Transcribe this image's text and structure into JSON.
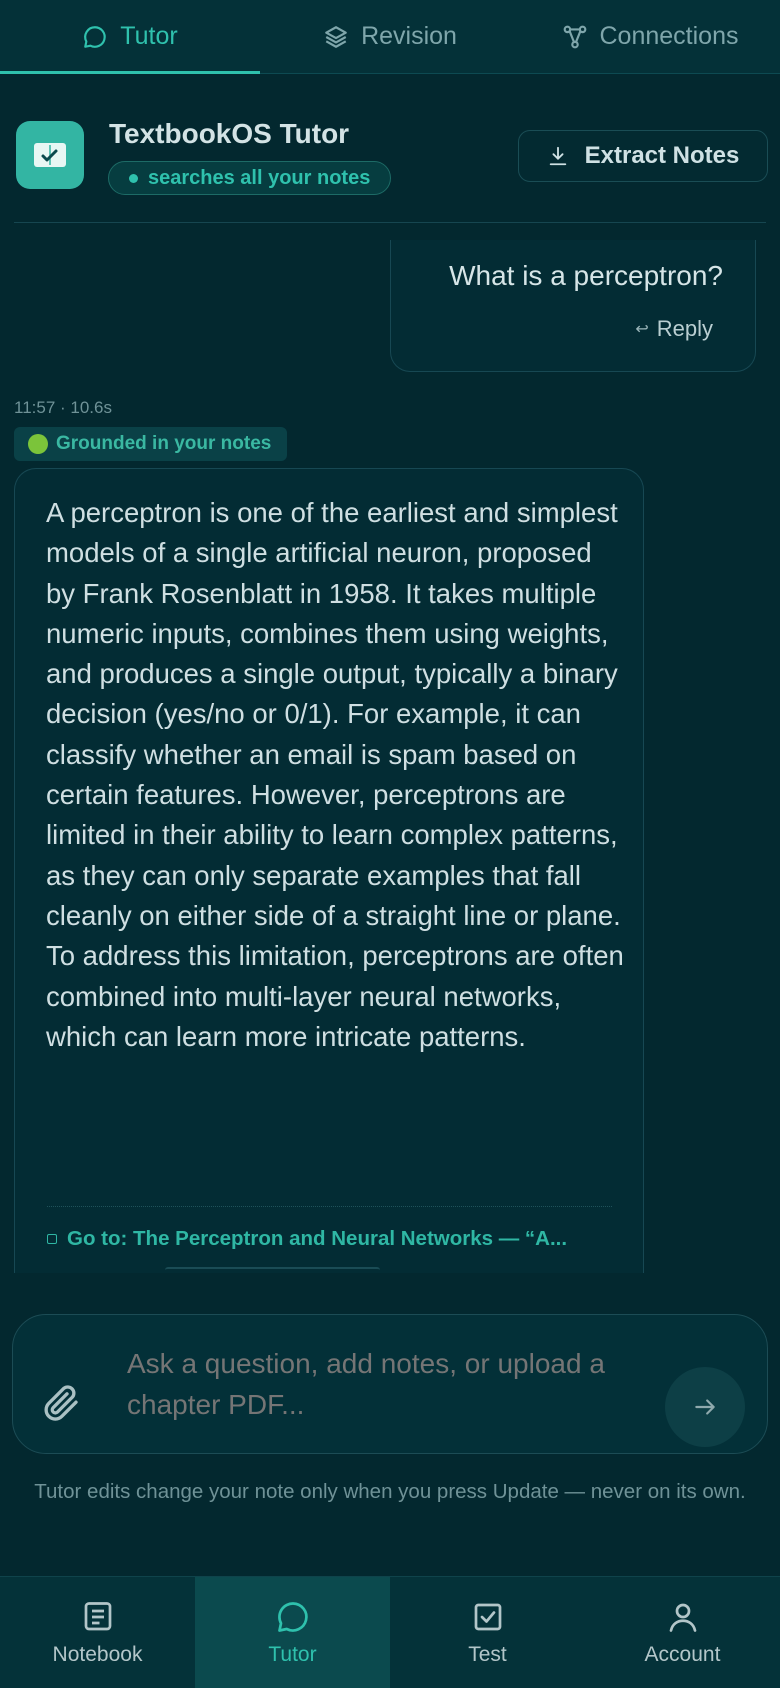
{
  "top_tabs": [
    {
      "label": "Tutor",
      "icon": "chat-bubble-icon",
      "active": true
    },
    {
      "label": "Revision",
      "icon": "layers-icon",
      "active": false
    },
    {
      "label": "Connections",
      "icon": "graph-nodes-icon",
      "active": false
    }
  ],
  "header": {
    "title": "TextbookOS Tutor",
    "status": "searches all your notes",
    "extract_button": "Extract Notes"
  },
  "conversation": {
    "user_message": "What is a perceptron?",
    "reply_label": "Reply",
    "assistant": {
      "meta": "11:57 · 10.6s",
      "grounded_label": "Grounded in your notes",
      "answer": "A perceptron is one of the earliest and simplest models of a single artificial neuron, proposed by Frank Rosenblatt in 1958. It takes multiple numeric inputs, combines them using weights, and produces a single output, typically a binary decision (yes/no or 0/1). For example, it can classify whether an email is spam based on certain features. However, perceptrons are limited in their ability to learn complex patterns, as they can only separate examples that fall cleanly on either side of a straight line or plane. To address this limitation, perceptrons are often combined into multi-layer neural networks, which can learn more intricate patterns.",
      "goto_link": "Go to: The Perceptron and Neural Networks — “A..."
    }
  },
  "composer": {
    "placeholder": "Ask a question, add notes, or upload a chapter PDF...",
    "footnote": "Tutor edits change your note only when you press Update — never on its own."
  },
  "bottom_nav": [
    {
      "label": "Notebook",
      "icon": "notebook-icon",
      "active": false
    },
    {
      "label": "Tutor",
      "icon": "chat-bubble-icon",
      "active": true
    },
    {
      "label": "Test",
      "icon": "checkbox-icon",
      "active": false
    },
    {
      "label": "Account",
      "icon": "person-icon",
      "active": false
    }
  ],
  "colors": {
    "background": "#03282f",
    "accent": "#2fc1ad",
    "grounded_dot": "#7bc43a"
  }
}
